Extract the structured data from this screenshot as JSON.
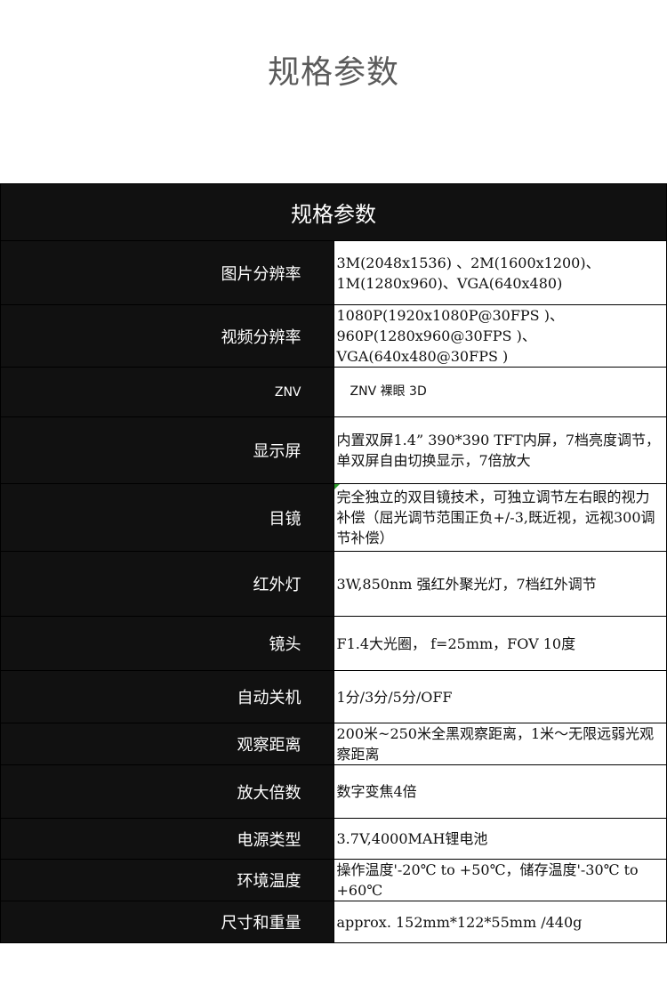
{
  "page": {
    "title": "规格参数"
  },
  "table": {
    "header": "规格参数",
    "rows": [
      {
        "label": "图片分辨率",
        "value": "3M(2048x1536) 、2M(1600x1200)、1M(1280x960)、VGA(640x480)"
      },
      {
        "label": "视频分辨率",
        "value": "1080P(1920x1080P@30FPS )、960P(1280x960@30FPS )、 VGA(640x480@30FPS )"
      },
      {
        "label": "ZNV",
        "value": "ZNV 裸眼 3D"
      },
      {
        "label": "显示屏",
        "value": "内置双屏1.4” 390*390 TFT内屏，7档亮度调节，单双屏自由切换显示，7倍放大"
      },
      {
        "label": "目镜",
        "value": " 完全独立的双目镜技术，可独立调节左右眼的视力补偿（屈光调节范围正负+/-3,既近视，远视300调节补偿）"
      },
      {
        "label": "红外灯",
        "value": "3W,850nm 强红外聚光灯，7档红外调节"
      },
      {
        "label": "镜头",
        "value": "F1.4大光圈， f=25mm，FOV 10度"
      },
      {
        "label": "自动关机",
        "value": "1分/3分/5分/OFF"
      },
      {
        "label": "观察距离",
        "value": "200米~250米全黑观察距离，1米～无限远弱光观察距离"
      },
      {
        "label": "放大倍数",
        "value": "数字变焦4倍"
      },
      {
        "label": "电源类型",
        "value": "3.7V,4000MAH锂电池"
      },
      {
        "label": "环境温度",
        "value": "操作温度'-20℃ to +50℃，储存温度'-30℃ to +60℃"
      },
      {
        "label": "尺寸和重量",
        "value": "approx. 152mm*122*55mm /440g"
      }
    ]
  }
}
